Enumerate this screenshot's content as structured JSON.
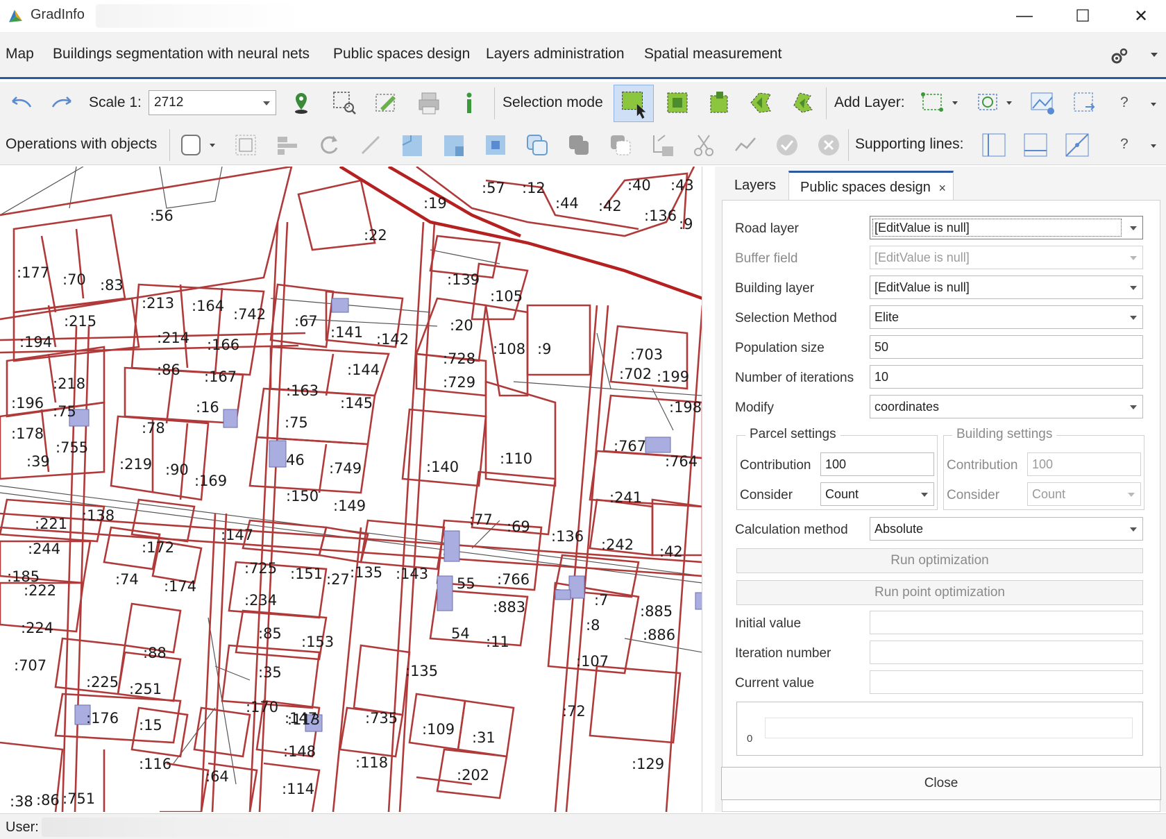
{
  "window": {
    "title": "GradInfo",
    "minimize_glyph": "—",
    "maximize_glyph": "☐",
    "close_glyph": "✕"
  },
  "menu": {
    "items": [
      "Map",
      "Buildings segmentation with neural nets",
      "Public spaces design",
      "Layers administration",
      "Spatial measurement"
    ],
    "settings_icon": "gears-icon"
  },
  "toolbar1": {
    "scale_label": "Scale 1:",
    "scale_value": "2712",
    "selection_mode_label": "Selection mode",
    "add_layer_label": "Add Layer:",
    "help_glyph": "?"
  },
  "toolbar2": {
    "operations_label": "Operations with objects",
    "supporting_lines_label": "Supporting lines:",
    "help_glyph": "?"
  },
  "map": {
    "parcel_color": "#b03a3a",
    "road_color": "#b52020",
    "building_fill": "#a9addf",
    "labels": [
      ":56",
      ":22",
      ":19",
      ":57",
      ":12",
      ":44",
      ":42",
      ":40",
      ":43",
      ":136",
      ":9",
      ":177",
      ":70",
      ":83",
      ":139",
      ":105",
      ":213",
      ":164",
      ":742",
      ":67",
      ":141",
      ":142",
      ":20",
      ":215",
      ":214",
      ":166",
      ":108",
      ":9",
      ":703",
      ":194",
      ":144",
      ":728",
      ":702",
      ":199",
      ":86",
      ":167",
      ":729",
      ":218",
      ":163",
      ":145",
      ":198",
      ":196",
      ":75",
      ":16",
      ":75",
      ":178",
      ":755",
      ":78",
      ":767",
      ":764",
      ":39",
      ":219",
      ":90",
      ":169",
      "46",
      ":749",
      ":140",
      ":110",
      ":150",
      ":149",
      ":241",
      ":221",
      ":138",
      ":77",
      ":69",
      ":136",
      ":172",
      ":147",
      ":242",
      ":42",
      ":244",
      ":725",
      ":151",
      ":27",
      ":135",
      ":143",
      "55",
      ":766",
      ":185",
      ":74",
      ":174",
      ":222",
      ":234",
      ":883",
      ":7",
      ":885",
      ":224",
      ":85",
      ":153",
      "54",
      ":11",
      ":8",
      ":886",
      ":88",
      ":707",
      ":35",
      ":135",
      ":107",
      ":225",
      ":251",
      ":170",
      ":147",
      ":735",
      ":109",
      ":72",
      ":176",
      ":15",
      ":113",
      ":31",
      ":148",
      ":118",
      ":116",
      ":64",
      ":114",
      ":202",
      ":129",
      ":38",
      ":86",
      ":751"
    ]
  },
  "panel": {
    "tabs": [
      "Layers",
      "Public spaces design"
    ],
    "tab_close_glyph": "×",
    "fields": {
      "road_layer": {
        "label": "Road layer",
        "value": "[EditValue is null]"
      },
      "buffer_field": {
        "label": "Buffer field",
        "value": "[EditValue is null]"
      },
      "building_layer": {
        "label": "Building layer",
        "value": "[EditValue is null]"
      },
      "selection_method": {
        "label": "Selection Method",
        "value": "Elite"
      },
      "population_size": {
        "label": "Population size",
        "value": "50"
      },
      "iterations": {
        "label": "Number of iterations",
        "value": "10"
      },
      "modify": {
        "label": "Modify",
        "value": "coordinates"
      }
    },
    "parcel_settings": {
      "title": "Parcel settings",
      "contribution_label": "Contribution",
      "contribution_value": "100",
      "consider_label": "Consider",
      "consider_value": "Count"
    },
    "building_settings": {
      "title": "Building settings",
      "contribution_label": "Contribution",
      "contribution_value": "100",
      "consider_label": "Consider",
      "consider_value": "Count"
    },
    "calculation_method": {
      "label": "Calculation method",
      "value": "Absolute"
    },
    "run_optimization": "Run optimization",
    "run_point_optimization": "Run point optimization",
    "initial_value_label": "Initial value",
    "iteration_number_label": "Iteration number",
    "current_value_label": "Current value",
    "chart_zero": "0",
    "close_button": "Close"
  },
  "status": {
    "user_label": "User:"
  }
}
